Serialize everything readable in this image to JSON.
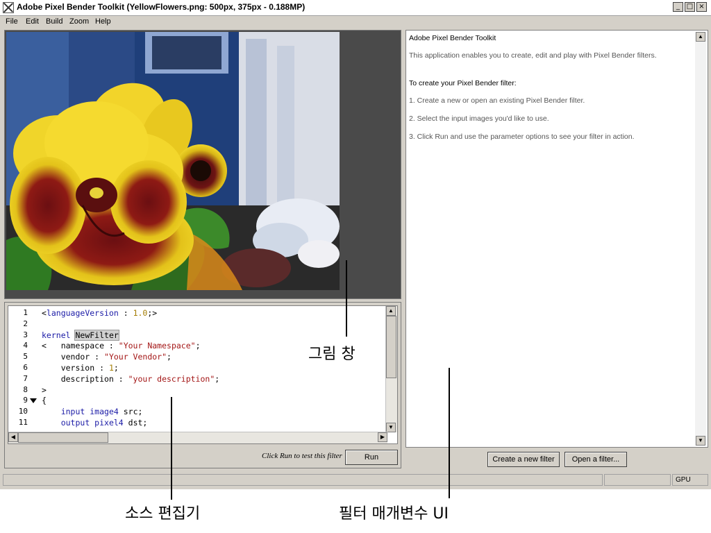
{
  "window": {
    "title": "Adobe Pixel Bender Toolkit (YellowFlowers.png: 500px, 375px - 0.188MP)",
    "controls": {
      "minimize": "_",
      "maximize": "□",
      "close": "×"
    }
  },
  "menu": {
    "items": [
      "File",
      "Edit",
      "Build",
      "Zoom",
      "Help"
    ]
  },
  "editor": {
    "lines": [
      {
        "n": "1",
        "segments": [
          [
            "plain",
            "<"
          ],
          [
            "kw",
            "languageVersion"
          ],
          [
            "plain",
            " : "
          ],
          [
            "num",
            "1.0"
          ],
          [
            "plain",
            ";>"
          ]
        ]
      },
      {
        "n": "2",
        "segments": []
      },
      {
        "n": "3",
        "segments": [
          [
            "kw",
            "kernel"
          ],
          [
            "plain",
            " "
          ],
          [
            "hl",
            "NewFilter"
          ]
        ]
      },
      {
        "n": "4",
        "segments": [
          [
            "plain",
            "<   namespace : "
          ],
          [
            "str",
            "\"Your Namespace\""
          ],
          [
            "plain",
            ";"
          ]
        ]
      },
      {
        "n": "5",
        "segments": [
          [
            "plain",
            "    vendor : "
          ],
          [
            "str",
            "\"Your Vendor\""
          ],
          [
            "plain",
            ";"
          ]
        ]
      },
      {
        "n": "6",
        "segments": [
          [
            "plain",
            "    version : "
          ],
          [
            "num",
            "1"
          ],
          [
            "plain",
            ";"
          ]
        ]
      },
      {
        "n": "7",
        "segments": [
          [
            "plain",
            "    description : "
          ],
          [
            "str",
            "\"your description\""
          ],
          [
            "plain",
            ";"
          ]
        ]
      },
      {
        "n": "8",
        "segments": [
          [
            "plain",
            ">"
          ]
        ]
      },
      {
        "n": "9",
        "segments": [
          [
            "plain",
            "{"
          ]
        ]
      },
      {
        "n": "10",
        "segments": [
          [
            "plain",
            "    "
          ],
          [
            "ty",
            "input image4"
          ],
          [
            "plain",
            " src;"
          ]
        ]
      },
      {
        "n": "11",
        "segments": [
          [
            "plain",
            "    "
          ],
          [
            "ty",
            "output pixel4"
          ],
          [
            "plain",
            " dst;"
          ]
        ]
      }
    ],
    "fold_line": "9",
    "hint": "Click Run to test this filter",
    "run_label": "Run"
  },
  "params": {
    "heading": "Adobe Pixel Bender Toolkit",
    "intro": "This application enables you to create, edit and play with Pixel Bender filters.",
    "subheading": "To create your Pixel Bender filter:",
    "steps": [
      "1. Create a new or open an existing Pixel Bender filter.",
      "2. Select the input images you'd like to use.",
      "3. Click Run and use the parameter options to see your filter in action."
    ],
    "create_label": "Create a new filter",
    "open_label": "Open a filter..."
  },
  "status": {
    "gpu": "GPU"
  },
  "annotations": {
    "image_window": "그림 창",
    "source_editor": "소스 편집기",
    "filter_params": "필터 매개변수 UI"
  }
}
